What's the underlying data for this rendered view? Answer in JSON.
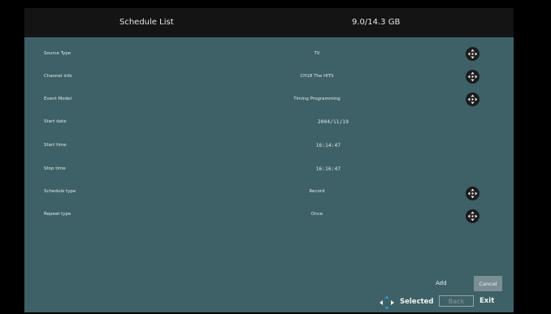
{
  "header": {
    "title": "Schedule List",
    "storage": "9.0/14.3 GB"
  },
  "rows": [
    {
      "label": "Source Type",
      "value": "TV",
      "has_selector": true
    },
    {
      "label": "Channel info",
      "value": "CH18  The HITS",
      "has_selector": true
    },
    {
      "label": "Event Model",
      "value": "Timing Programming",
      "has_selector": true
    },
    {
      "label": "Start date",
      "value": "2004/11/19",
      "has_selector": false
    },
    {
      "label": "Start time",
      "value": "16:14:47",
      "has_selector": false
    },
    {
      "label": "Stop time",
      "value": "16:16:47",
      "has_selector": false
    },
    {
      "label": "Schedule type",
      "value": "Record",
      "has_selector": true
    },
    {
      "label": "Repeat type",
      "value": "Once",
      "has_selector": true
    }
  ],
  "buttons": {
    "add": "Add",
    "cancel": "Cancel"
  },
  "nav": {
    "selected": "Selected",
    "back": "Back",
    "exit": "Exit"
  },
  "colors": {
    "panel": "#3d6166",
    "header": "#141414",
    "cancel_button": "#7a8f93"
  },
  "icons": {
    "selector": "dpad-arrows-icon",
    "navigation": "dpad-navigation-icon"
  }
}
